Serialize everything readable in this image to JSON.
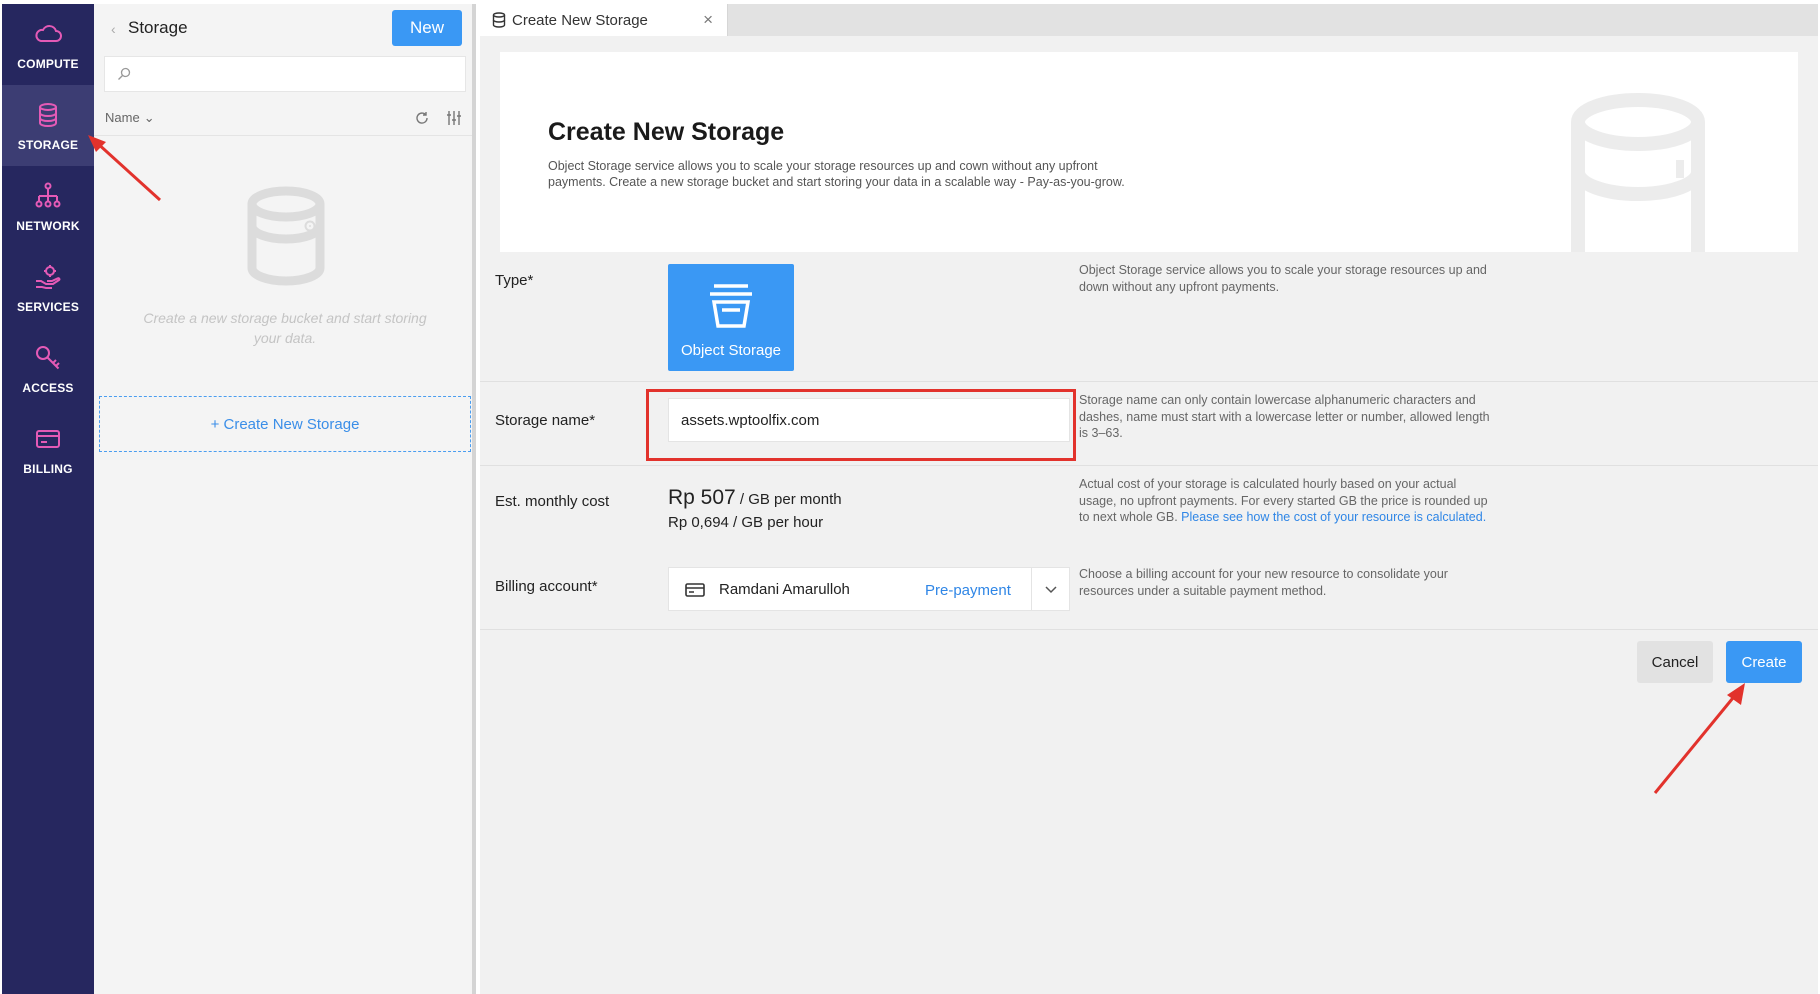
{
  "nav": {
    "items": [
      {
        "label": "COMPUTE",
        "icon": "cloud-icon"
      },
      {
        "label": "STORAGE",
        "icon": "database-icon",
        "active": true
      },
      {
        "label": "NETWORK",
        "icon": "network-icon"
      },
      {
        "label": "SERVICES",
        "icon": "services-hand-icon"
      },
      {
        "label": "ACCESS",
        "icon": "key-icon"
      },
      {
        "label": "BILLING",
        "icon": "credit-card-icon"
      }
    ]
  },
  "list_panel": {
    "title": "Storage",
    "new_button": "New",
    "search_value": "",
    "sort_label": "Name",
    "empty_text": "Create a new storage bucket and start storing your data.",
    "create_link": "+ Create New Storage"
  },
  "tab": {
    "label": "Create New Storage",
    "close": "×"
  },
  "hero": {
    "title": "Create New Storage",
    "description": "Object Storage service allows you to scale your storage resources up and cown without any upfront payments. Create a new storage bucket and start storing your data in a scalable way - Pay-as-you-grow."
  },
  "form": {
    "type": {
      "label": "Type*",
      "option": "Object Storage",
      "help": "Object Storage service allows you to scale your storage resources up and down without any upfront payments."
    },
    "name": {
      "label": "Storage name*",
      "value": "assets.wptoolfix.com",
      "help": "Storage name can only contain lowercase alphanumeric characters and dashes, name must start with a lowercase letter or number, allowed length is 3–63."
    },
    "cost": {
      "label": "Est. monthly cost",
      "amount": "Rp 507",
      "unit": " / GB per month",
      "hourly": "Rp 0,694 / GB per hour",
      "help": "Actual cost of your storage is calculated hourly based on your actual usage, no upfront payments. For every started GB the price is rounded up to next whole GB. ",
      "help_link": "Please see how the cost of your resource is calculated."
    },
    "billing": {
      "label": "Billing account*",
      "account": "Ramdani Amarulloh",
      "type": "Pre-payment",
      "help": "Choose a billing account for your new resource to consolidate your resources under a suitable payment method."
    }
  },
  "actions": {
    "cancel": "Cancel",
    "create": "Create"
  },
  "colors": {
    "nav_bg": "#26275f",
    "nav_icon": "#e45ab6",
    "accent": "#3a98f4",
    "annotation": "#e2322c"
  }
}
